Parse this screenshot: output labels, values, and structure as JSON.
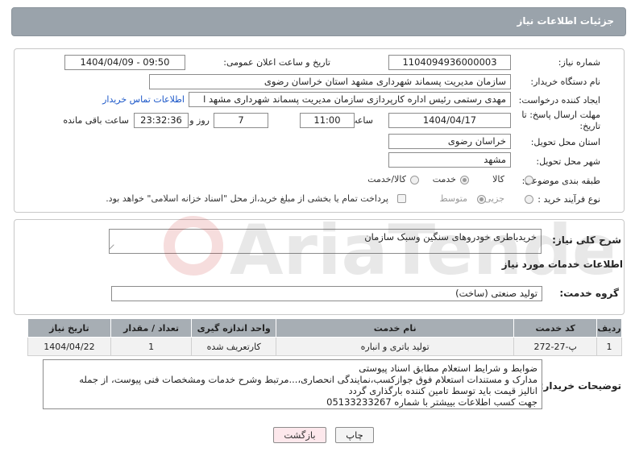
{
  "header": {
    "title": "جزئیات اطلاعات نیاز"
  },
  "form": {
    "need_number": {
      "label": "شماره نیاز:",
      "value": "1104094936000003"
    },
    "announce_datetime": {
      "label": "تاریخ و ساعت اعلان عمومی:",
      "value": "1404/04/09 - 09:50"
    },
    "buyer_org": {
      "label": "نام دستگاه خریدار:",
      "value": "سازمان مدیریت پسماند شهرداری مشهد استان خراسان رضوی"
    },
    "requester": {
      "label": "ایجاد کننده درخواست:",
      "value": "مهدی رستمی رئیس اداره کارپردازی سازمان مدیریت پسماند شهرداری مشهد ا",
      "contact_link": "اطلاعات تماس خریدار"
    },
    "deadline": {
      "label": "مهلت ارسال پاسخ: تا تاریخ:",
      "date": "1404/04/17",
      "time_label": "ساعت",
      "time": "11:00",
      "days": "7",
      "days_label": "روز و",
      "remaining": "23:32:36",
      "remaining_label": "ساعت باقی مانده"
    },
    "province": {
      "label": "استان محل تحویل:",
      "value": "خراسان رضوی"
    },
    "city": {
      "label": "شهر محل تحویل:",
      "value": "مشهد"
    },
    "category": {
      "label": "طبقه بندی موضوعی:",
      "options": [
        "کالا",
        "خدمت",
        "کالا/خدمت"
      ],
      "selected": "خدمت"
    },
    "process": {
      "label": "نوع فرآیند خرید :",
      "options": [
        "جزیی",
        "متوسط"
      ],
      "selected": "متوسط",
      "payment_note": "پرداخت تمام یا بخشی از مبلغ خرید،از محل \"اسناد خزانه اسلامی\" خواهد بود."
    }
  },
  "summary": {
    "label": "شرح کلی نیاز:",
    "value": "خریدباطری خودروهای سنگین وسبک سازمان"
  },
  "services": {
    "title": "اطلاعات خدمات مورد نیاز",
    "group_label": "گروه خدمت:",
    "group_value": "تولید صنعتی (ساخت)",
    "columns": [
      "ردیف",
      "کد خدمت",
      "نام خدمت",
      "واحد اندازه گیری",
      "تعداد / مقدار",
      "تاریخ نیاز"
    ],
    "rows": [
      {
        "idx": "1",
        "code": "پ-27-272",
        "name": "تولید باتری و انباره",
        "unit": "کارتعریف شده",
        "qty": "1",
        "date": "1404/04/22"
      }
    ]
  },
  "buyer_notes": {
    "label": "توضیحات خریدار:",
    "lines": [
      "ضوابط و شرایط استعلام مطابق اسناد پیوستی",
      "مدارک و مستندات استعلام فوق جوازکسب،نمایندگی انحصاری،...مرتبط وشرح خدمات ومشخصات فنی پیوست، از جمله",
      "انالیز قیمت باید توسط تامین کننده بارگذاری گردد",
      "جهت کسب اطلاعات بییشتر با شماره 05133233267"
    ]
  },
  "buttons": {
    "print": "چاپ",
    "back": "بازگشت"
  },
  "watermark": {
    "text": "AriaTender.neT"
  },
  "colors": {
    "header_bg": "#9aa3ab",
    "table_header": "#a7aeb4",
    "link": "#1a56c8",
    "back_button_bg": "#fde8ec"
  }
}
